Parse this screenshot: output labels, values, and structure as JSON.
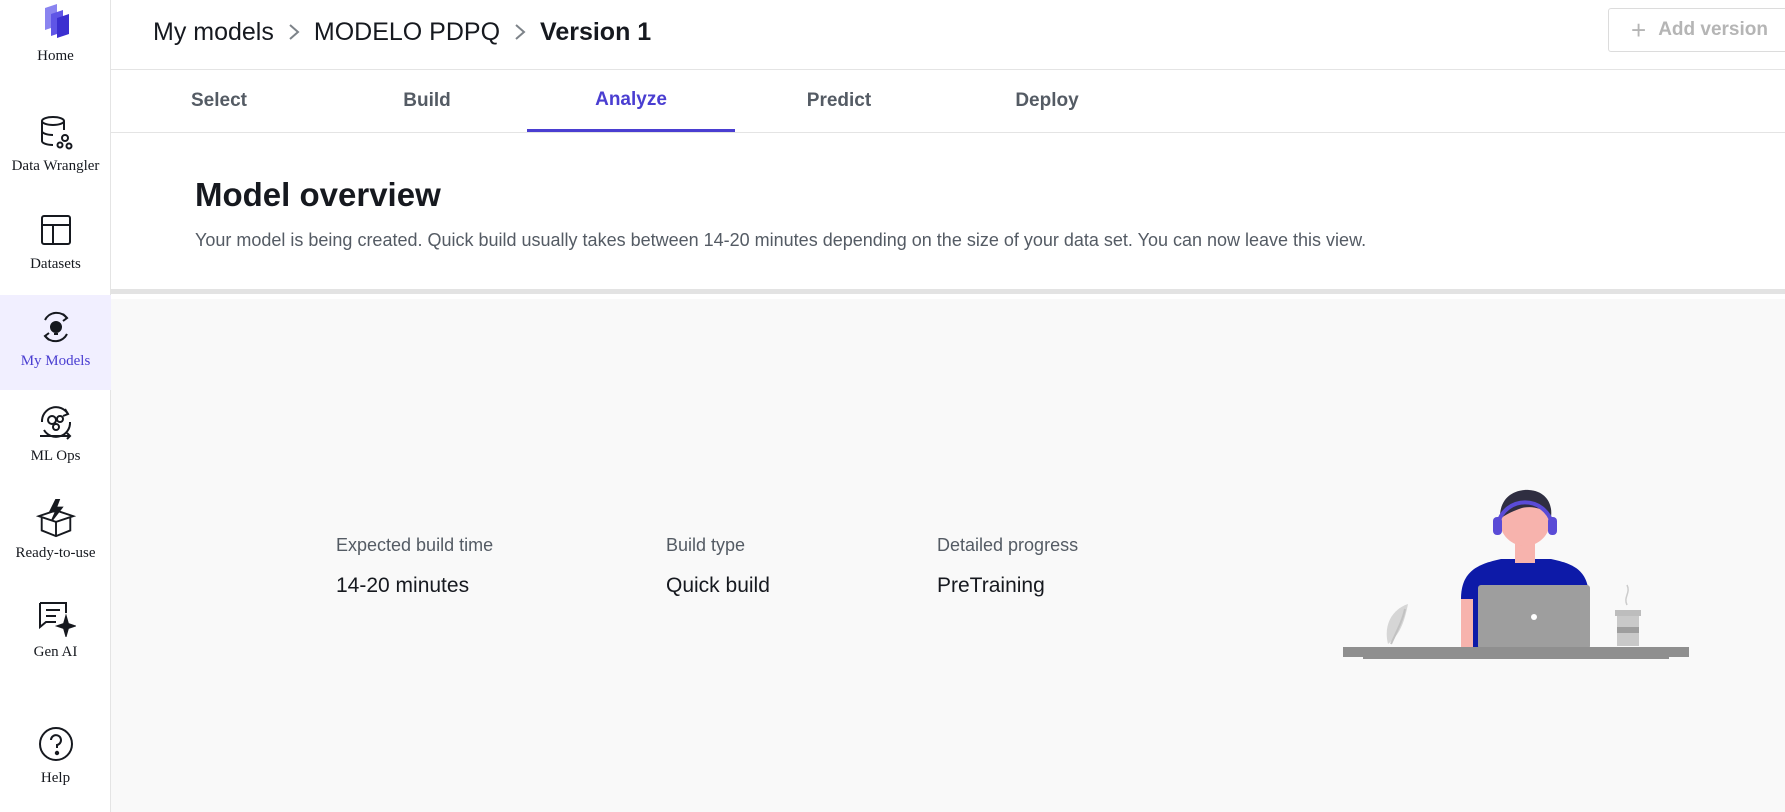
{
  "sidebar": {
    "items": [
      {
        "label": "Home",
        "icon": "canvas-logo-icon"
      },
      {
        "label": "Data Wrangler",
        "icon": "database-icon"
      },
      {
        "label": "Datasets",
        "icon": "table-icon"
      },
      {
        "label": "My Models",
        "icon": "model-bulb-icon",
        "active": true
      },
      {
        "label": "ML Ops",
        "icon": "ml-ops-icon"
      },
      {
        "label": "Ready-to-use",
        "icon": "box-lightning-icon"
      },
      {
        "label": "Gen AI",
        "icon": "chat-sparkle-icon"
      },
      {
        "label": "Help",
        "icon": "help-circle-icon"
      }
    ]
  },
  "breadcrumb": {
    "items": [
      "My models",
      "MODELO PDPQ",
      "Version 1"
    ]
  },
  "header": {
    "add_version_label": "Add version"
  },
  "tabs": [
    "Select",
    "Build",
    "Analyze",
    "Predict",
    "Deploy"
  ],
  "active_tab": "Analyze",
  "overview": {
    "title": "Model overview",
    "description": "Your model is being created. Quick build usually takes between 14-20 minutes depending on the size of your data set. You can now leave this view."
  },
  "build_info": {
    "expected_build_time_label": "Expected build time",
    "expected_build_time_value": "14-20 minutes",
    "build_type_label": "Build type",
    "build_type_value": "Quick build",
    "detailed_progress_label": "Detailed progress",
    "detailed_progress_value": "PreTraining"
  },
  "colors": {
    "accent": "#4a3ed1",
    "active_nav_bg": "#f1efff",
    "content_bg": "#f9f9f9",
    "shirt": "#0d1aa8",
    "headphones": "#5a4bd6"
  }
}
